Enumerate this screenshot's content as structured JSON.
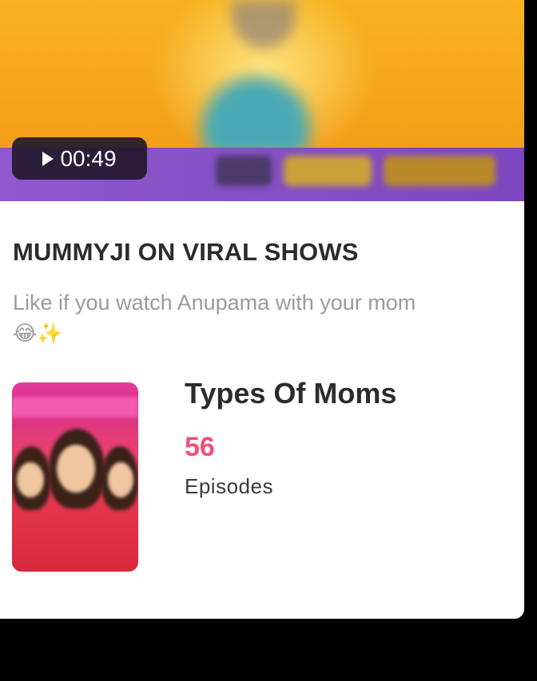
{
  "video": {
    "duration": "00:49"
  },
  "post": {
    "title": "MUMMYJI ON VIRAL SHOWS",
    "description": "Like if you watch Anupama with your mom",
    "emojis": "😂✨"
  },
  "show": {
    "name": "Types Of Moms",
    "episode_count": "56",
    "episodes_label": "Episodes"
  },
  "colors": {
    "accent": "#f0507a",
    "title_text": "#2c2c30",
    "muted_text": "#9a9aa0"
  }
}
